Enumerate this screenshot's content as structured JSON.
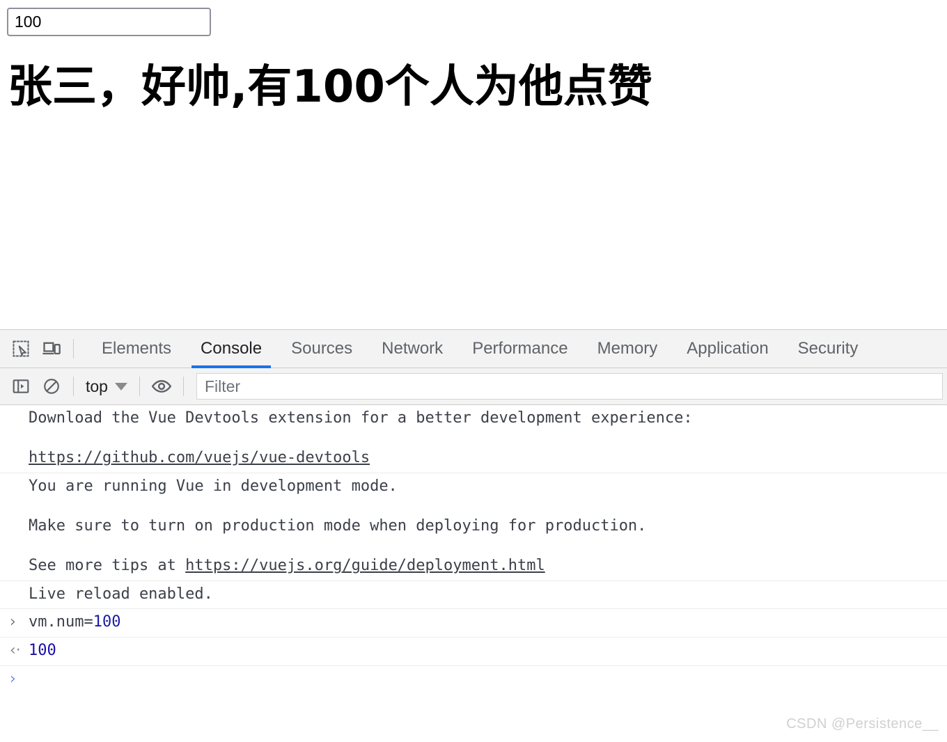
{
  "page": {
    "input": {
      "value": "100",
      "placeholder": ""
    },
    "headline": "张三，好帅,有100个人为他点赞"
  },
  "devtools": {
    "icons": {
      "inspect": "inspect-element-icon",
      "device": "device-toolbar-icon",
      "sidebar": "console-sidebar-icon",
      "clear": "clear-console-icon",
      "eye": "live-expression-eye-icon",
      "caret": "chevron-down-icon"
    },
    "tabs": [
      {
        "label": "Elements",
        "active": false
      },
      {
        "label": "Console",
        "active": true
      },
      {
        "label": "Sources",
        "active": false
      },
      {
        "label": "Network",
        "active": false
      },
      {
        "label": "Performance",
        "active": false
      },
      {
        "label": "Memory",
        "active": false
      },
      {
        "label": "Application",
        "active": false
      },
      {
        "label": "Security",
        "active": false
      }
    ],
    "toolbar": {
      "context": "top",
      "filter_placeholder": "Filter",
      "filter_value": ""
    },
    "console": {
      "messages": [
        {
          "type": "log",
          "line1": "Download the Vue Devtools extension for a better development experience:",
          "link1": "https://github.com/vuejs/vue-devtools"
        },
        {
          "type": "log",
          "line1": "You are running Vue in development mode.",
          "line2": "Make sure to turn on production mode when deploying for production.",
          "line3_prefix": "See more tips at ",
          "link1": "https://vuejs.org/guide/deployment.html"
        },
        {
          "type": "log",
          "line1": "Live reload enabled."
        }
      ],
      "eval_input": {
        "marker": "›",
        "expr_prefix": "vm.num=",
        "expr_value": "100"
      },
      "eval_output": {
        "marker": "‹·",
        "value": "100"
      },
      "prompt": {
        "marker": "›",
        "value": ""
      }
    },
    "accent_color": "#1a73e8"
  },
  "watermark": "CSDN @Persistence__"
}
